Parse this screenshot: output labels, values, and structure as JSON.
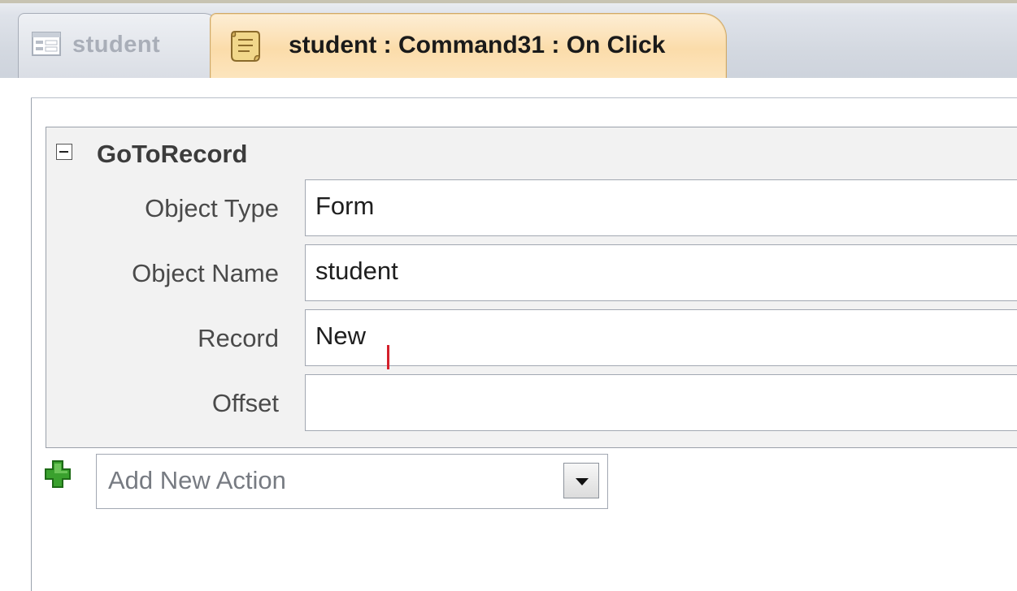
{
  "tabs": [
    {
      "label": "student",
      "icon": "form-icon",
      "active": false
    },
    {
      "label": "student : Command31 : On Click",
      "icon": "macro-icon",
      "active": true
    }
  ],
  "action": {
    "name": "GoToRecord",
    "collapse_icon": "collapse-minus-icon",
    "arguments": [
      {
        "label": "Object Type",
        "value": "Form"
      },
      {
        "label": "Object Name",
        "value": "student"
      },
      {
        "label": "Record",
        "value": "New"
      },
      {
        "label": "Offset",
        "value": ""
      }
    ]
  },
  "add_action": {
    "placeholder": "Add New Action",
    "icon": "green-plus-icon",
    "dropdown_icon": "chevron-down-icon"
  },
  "colors": {
    "active_tab": "#fbdcaa",
    "tab_strip": "#d3d8e0",
    "action_block": "#f2f2f2",
    "plus_green": "#3aa12e",
    "cursor": "#d4202b"
  }
}
